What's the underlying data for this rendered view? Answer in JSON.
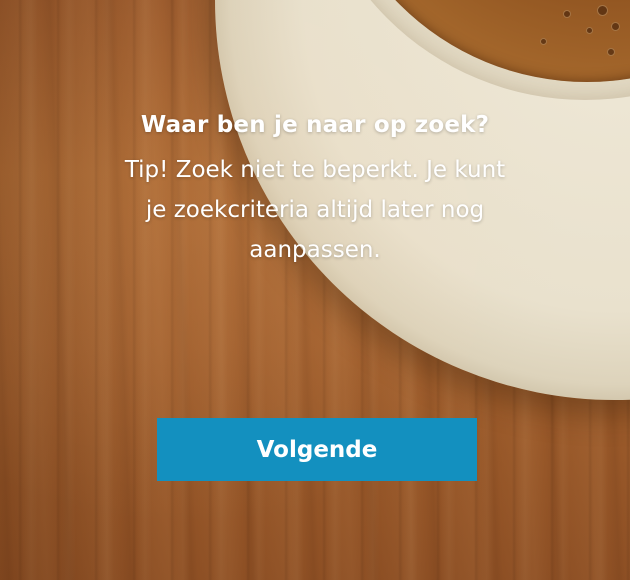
{
  "question": {
    "heading": "Waar ben je naar op zoek?",
    "tip": "Tip! Zoek niet te beperkt. Je kunt je zoekcriteria altijd later nog aanpassen."
  },
  "actions": {
    "next_label": "Volgende"
  },
  "colors": {
    "button": "#1390bf",
    "text": "#ffffff",
    "background": "#a05e2c"
  },
  "background": {
    "image": "coffee-cup-on-wooden-table"
  }
}
